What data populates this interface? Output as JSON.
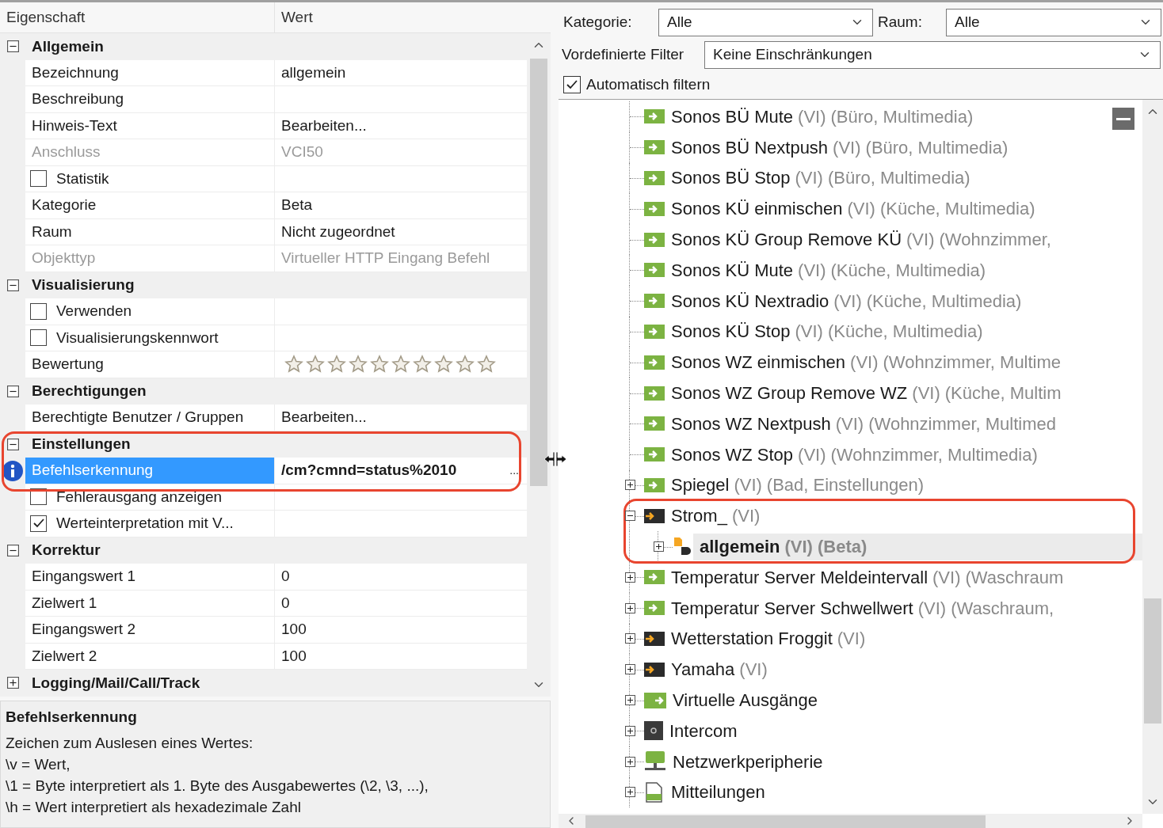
{
  "properties": {
    "columns": [
      "Eigenschaft",
      "Wert"
    ],
    "rows": [
      {
        "kind": "category",
        "label": "Allgemein",
        "expanded": true
      },
      {
        "kind": "text",
        "name": "Bezeichnung",
        "value": "allgemein",
        "disabled": false,
        "selected": false
      },
      {
        "kind": "text",
        "name": "Beschreibung",
        "disabled": false,
        "selected": false
      },
      {
        "kind": "text",
        "name": "Hinweis-Text",
        "value": "Bearbeiten...",
        "disabled": false,
        "selected": false
      },
      {
        "kind": "text",
        "name": "Anschluss",
        "value": "VCI50",
        "disabled": true,
        "selected": false
      },
      {
        "kind": "checkbox",
        "name": "Statistik",
        "checked": false,
        "selected": false
      },
      {
        "kind": "text",
        "name": "Kategorie",
        "value": "Beta",
        "disabled": false,
        "selected": false
      },
      {
        "kind": "text",
        "name": "Raum",
        "value": "Nicht zugeordnet",
        "disabled": false,
        "selected": false
      },
      {
        "kind": "text",
        "name": "Objekttyp",
        "value": "Virtueller HTTP Eingang Befehl",
        "disabled": true,
        "selected": false
      },
      {
        "kind": "category",
        "label": "Visualisierung",
        "expanded": true
      },
      {
        "kind": "checkbox",
        "name": "Verwenden",
        "checked": false,
        "selected": false
      },
      {
        "kind": "checkbox",
        "name": "Visualisierungskennwort",
        "checked": false,
        "selected": false
      },
      {
        "kind": "stars",
        "name": "Bewertung",
        "stars": 0,
        "selected": false
      },
      {
        "kind": "category",
        "label": "Berechtigungen",
        "expanded": true
      },
      {
        "kind": "text",
        "name": "Berechtigte Benutzer / Gruppen",
        "value": "Bearbeiten...",
        "disabled": false,
        "selected": false
      },
      {
        "kind": "category",
        "label": "Einstellungen",
        "expanded": true
      },
      {
        "kind": "text",
        "name": "Befehlserkennung",
        "value": "/cm?cmnd=status%2010",
        "button": "...",
        "disabled": false,
        "selected": true
      },
      {
        "kind": "checkbox",
        "name": "Fehlerausgang anzeigen",
        "checked": false,
        "selected": false
      },
      {
        "kind": "checkbox",
        "name": "Werteinterpretation mit V...",
        "checked": true,
        "selected": false
      },
      {
        "kind": "category",
        "label": "Korrektur",
        "expanded": true
      },
      {
        "kind": "text",
        "name": "Eingangswert 1",
        "value": "0",
        "disabled": false,
        "selected": false
      },
      {
        "kind": "text",
        "name": "Zielwert 1",
        "value": "0",
        "disabled": false,
        "selected": false
      },
      {
        "kind": "text",
        "name": "Eingangswert 2",
        "value": "100",
        "disabled": false,
        "selected": false
      },
      {
        "kind": "text",
        "name": "Zielwert 2",
        "value": "100",
        "disabled": false,
        "selected": false
      },
      {
        "kind": "category",
        "label": "Logging/Mail/Call/Track",
        "expanded": false
      }
    ]
  },
  "description": {
    "title": "Befehlserkennung",
    "lines": [
      "Zeichen zum Auslesen eines Wertes:",
      "\\v = Wert,",
      "\\1 = Byte interpretiert als 1. Byte des Ausgabewertes (\\2, \\3, ...),",
      "\\h = Wert interpretiert als hexadezimale Zahl"
    ]
  },
  "filters": {
    "kategorie": {
      "label": "Kategorie:",
      "value": "Alle"
    },
    "raum": {
      "label": "Raum:",
      "value": "Alle"
    },
    "vordefiniert": {
      "label": "Vordefinierte Filter",
      "value": "Keine Einschränkungen"
    },
    "auto_filter": {
      "label": "Automatisch filtern",
      "checked": true
    }
  },
  "tree": {
    "items": [
      {
        "children": [
          {
            "name": "Sonos BÜ Mute",
            "type": "(VI)",
            "detail": "(Büro, Multimedia)",
            "kind": "input",
            "selected": false
          },
          {
            "name": "Sonos BÜ Nextpush",
            "type": "(VI)",
            "detail": "(Büro, Multimedia)",
            "kind": "input",
            "selected": false
          },
          {
            "name": "Sonos BÜ Stop",
            "type": "(VI)",
            "detail": "(Büro, Multimedia)",
            "kind": "input",
            "selected": false
          },
          {
            "name": "Sonos KÜ einmischen",
            "type": "(VI)",
            "detail": "(Küche, Multimedia)",
            "kind": "input",
            "selected": false
          },
          {
            "name": "Sonos KÜ Group Remove KÜ",
            "type": "(VI)",
            "detail": "(Wohnzimmer,",
            "kind": "input",
            "selected": false
          },
          {
            "name": "Sonos KÜ Mute",
            "type": "(VI)",
            "detail": "(Küche, Multimedia)",
            "kind": "input",
            "selected": false
          },
          {
            "name": "Sonos KÜ Nextradio",
            "type": "(VI)",
            "detail": "(Küche, Multimedia)",
            "kind": "input",
            "selected": false
          },
          {
            "name": "Sonos KÜ Stop",
            "type": "(VI)",
            "detail": "(Küche, Multimedia)",
            "kind": "input",
            "selected": false
          },
          {
            "name": "Sonos WZ einmischen",
            "type": "(VI)",
            "detail": "(Wohnzimmer, Multime",
            "kind": "input",
            "selected": false
          },
          {
            "name": "Sonos WZ Group Remove WZ",
            "type": "(VI)",
            "detail": "(Küche, Multim",
            "kind": "input",
            "selected": false
          },
          {
            "name": "Sonos WZ Nextpush",
            "type": "(VI)",
            "detail": "(Wohnzimmer, Multimed",
            "kind": "input",
            "selected": false
          },
          {
            "name": "Sonos WZ Stop",
            "type": "(VI)",
            "detail": "(Wohnzimmer, Multimedia)",
            "kind": "input",
            "selected": false
          },
          {
            "name": "Spiegel",
            "type": "(VI)",
            "detail": "(Bad, Einstellungen)",
            "kind": "input",
            "expanded": false,
            "selected": false
          },
          {
            "name": "Strom_",
            "type": "(VI)",
            "kind": "dark-input",
            "expanded": true,
            "selected": false,
            "children": [
              {
                "name": "allgemein",
                "type": "(VI)",
                "detail": "(Beta)",
                "kind": "document",
                "expanded": false,
                "selected": true
              }
            ]
          },
          {
            "name": "Temperatur Server Meldeintervall",
            "type": "(VI)",
            "detail": "(Waschraum",
            "kind": "input",
            "expanded": false,
            "selected": false
          },
          {
            "name": "Temperatur Server Schwellwert",
            "type": "(VI)",
            "detail": "(Waschraum,",
            "kind": "input",
            "expanded": false,
            "selected": false
          },
          {
            "name": "Wetterstation Froggit",
            "type": "(VI)",
            "kind": "dark-input",
            "expanded": false,
            "selected": false
          },
          {
            "name": "Yamaha",
            "type": "(VI)",
            "kind": "dark-input",
            "expanded": false,
            "selected": false
          }
        ]
      },
      {
        "name": "Virtuelle Ausgänge",
        "kind": "output",
        "expanded": false,
        "selected": false
      },
      {
        "name": "Intercom",
        "kind": "intercom",
        "expanded": false,
        "selected": false
      },
      {
        "name": "Netzwerkperipherie",
        "kind": "network",
        "expanded": false,
        "selected": false
      },
      {
        "name": "Mitteilungen",
        "kind": "message",
        "expanded": false,
        "selected": false
      }
    ]
  }
}
